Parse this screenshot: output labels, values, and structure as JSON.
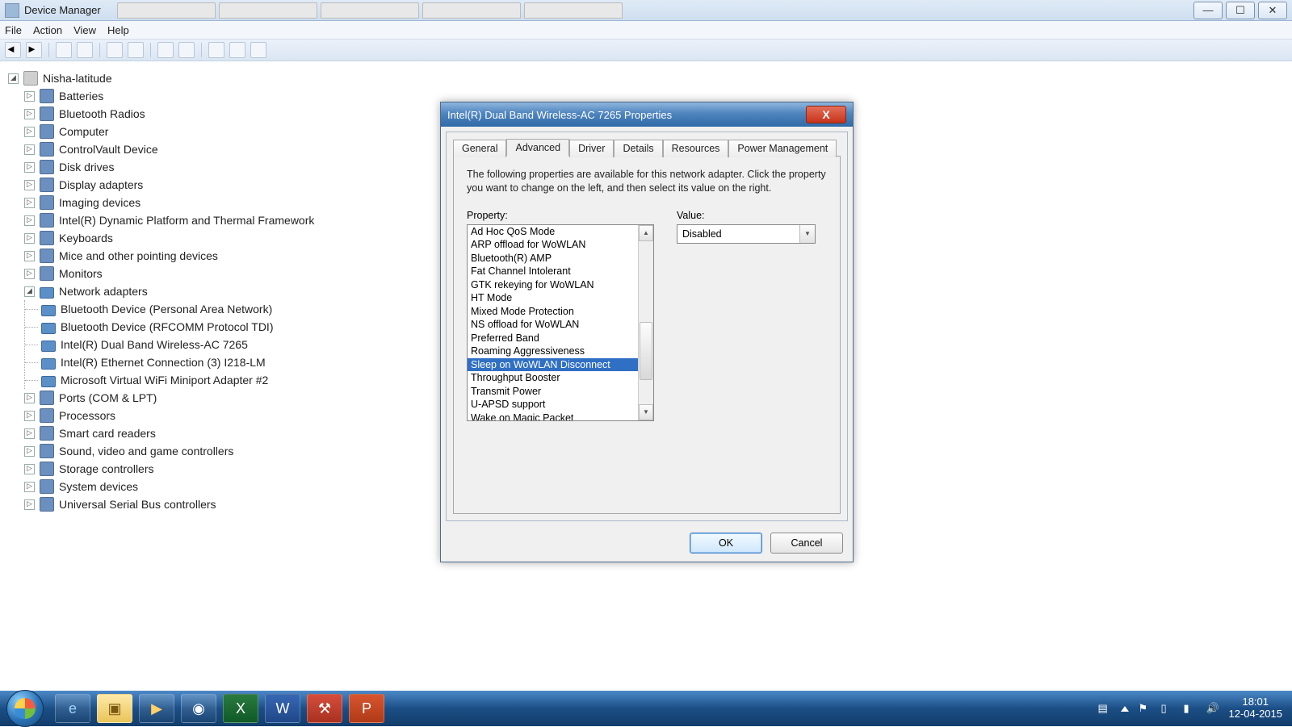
{
  "window": {
    "title": "Device Manager"
  },
  "menu": {
    "file": "File",
    "action": "Action",
    "view": "View",
    "help": "Help"
  },
  "tree": {
    "root": "Nisha-latitude",
    "items": [
      "Batteries",
      "Bluetooth Radios",
      "Computer",
      "ControlVault Device",
      "Disk drives",
      "Display adapters",
      "Imaging devices",
      "Intel(R) Dynamic Platform and Thermal Framework",
      "Keyboards",
      "Mice and other pointing devices",
      "Monitors"
    ],
    "network_label": "Network adapters",
    "network_children": [
      "Bluetooth Device (Personal Area Network)",
      "Bluetooth Device (RFCOMM Protocol TDI)",
      "Intel(R) Dual Band Wireless-AC 7265",
      "Intel(R) Ethernet Connection (3) I218-LM",
      "Microsoft Virtual WiFi Miniport Adapter #2"
    ],
    "items2": [
      "Ports (COM & LPT)",
      "Processors",
      "Smart card readers",
      "Sound, video and game controllers",
      "Storage controllers",
      "System devices",
      "Universal Serial Bus controllers"
    ]
  },
  "dialog": {
    "title": "Intel(R) Dual Band Wireless-AC 7265 Properties",
    "tabs": {
      "general": "General",
      "advanced": "Advanced",
      "driver": "Driver",
      "details": "Details",
      "resources": "Resources",
      "power": "Power Management"
    },
    "desc": "The following properties are available for this network adapter. Click the property you want to change on the left, and then select its value on the right.",
    "property_label": "Property:",
    "value_label": "Value:",
    "properties": [
      "Ad Hoc QoS Mode",
      "ARP offload for WoWLAN",
      "Bluetooth(R) AMP",
      "Fat Channel Intolerant",
      "GTK rekeying for WoWLAN",
      "HT Mode",
      "Mixed Mode Protection",
      "NS offload for WoWLAN",
      "Preferred Band",
      "Roaming Aggressiveness",
      "Sleep on WoWLAN Disconnect",
      "Throughput Booster",
      "Transmit Power",
      "U-APSD support",
      "Wake on Magic Packet"
    ],
    "selected_property_index": 10,
    "value": "Disabled",
    "ok": "OK",
    "cancel": "Cancel"
  },
  "taskbar": {
    "time": "18:01",
    "date": "12-04-2015"
  }
}
